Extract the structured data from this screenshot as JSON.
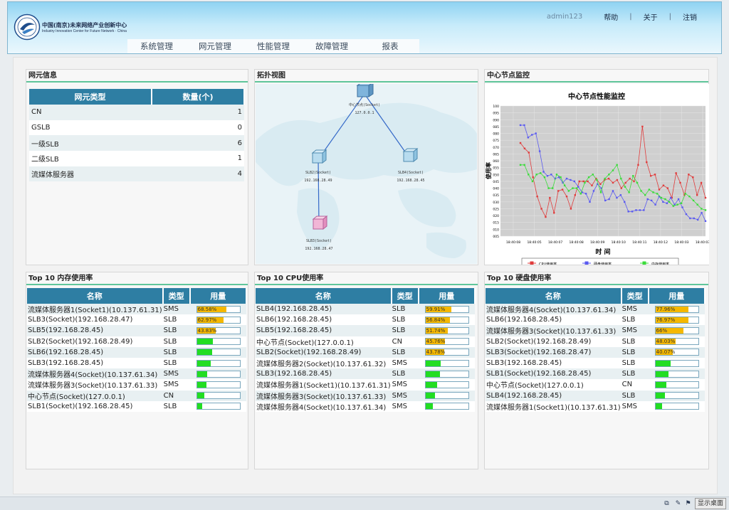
{
  "header": {
    "org_cn": "中国(南京)未来网络产业创新中心",
    "org_en": "Industry Innovation Center for Future Network · China",
    "user": "admin123",
    "links": [
      "帮助",
      "关于",
      "注销"
    ],
    "nav": [
      "系统管理",
      "网元管理",
      "性能管理",
      "故障管理",
      "报表"
    ]
  },
  "ne_info": {
    "title": "网元信息",
    "columns": [
      "网元类型",
      "数量(个)"
    ],
    "rows": [
      {
        "type": "CN",
        "count": "1"
      },
      {
        "type": "GSLB",
        "count": "0"
      },
      {
        "type": "一级SLB",
        "count": "6"
      },
      {
        "type": "二级SLB",
        "count": "1"
      },
      {
        "type": "流媒体服务器",
        "count": "4"
      }
    ]
  },
  "topology": {
    "title": "拓扑视图",
    "nodes": [
      {
        "name": "中心节点(Socket)",
        "ip": "127.0.0.1"
      },
      {
        "name": "SLB2(Socket)",
        "ip": "192.168.28.49"
      },
      {
        "name": "SLB4(Socket)",
        "ip": "192.168.28.45"
      },
      {
        "name": "SLB3(Socket)",
        "ip": "192.168.28.47"
      }
    ]
  },
  "monitor": {
    "title": "中心节点监控",
    "chart_title": "中心节点性能监控",
    "ylabel": "使用率",
    "xlabel": "时 间",
    "xticks": [
      "18:40:08",
      "18:40:05",
      "18:40:07",
      "18:40:08",
      "18:40:09",
      "18:40:10",
      "18:40:11",
      "18:40:12",
      "18:40:03",
      "18:40:03"
    ],
    "yticks": [
      "100",
      "095",
      "090",
      "085",
      "080",
      "075",
      "070",
      "065",
      "060",
      "055",
      "050",
      "045",
      "040",
      "035",
      "030",
      "025",
      "020",
      "015",
      "010",
      "005"
    ],
    "legend": [
      "CPU使用率",
      "硬盘使用率",
      "内存使用率"
    ]
  },
  "chart_data": {
    "type": "line",
    "title": "中心节点性能监控",
    "xlabel": "时 间",
    "ylabel": "使用率",
    "ylim": [
      5,
      100
    ],
    "grid": true,
    "legend_position": "bottom",
    "series": [
      {
        "name": "CPU使用率",
        "color": "#e03c3c",
        "values": [
          73,
          69,
          66,
          48,
          34,
          25,
          19,
          33,
          22,
          38,
          39,
          34,
          25,
          35,
          45,
          45,
          45,
          42,
          47,
          43,
          46,
          47,
          44,
          46,
          40,
          44,
          47,
          45,
          57,
          85,
          59,
          49,
          50,
          39,
          42,
          40,
          33,
          51,
          44,
          35,
          50,
          48,
          35,
          44,
          33
        ]
      },
      {
        "name": "硬盘使用率",
        "color": "#5a5af0",
        "values": [
          86,
          86,
          77,
          79,
          80,
          67,
          52,
          49,
          50,
          47,
          48,
          44,
          47,
          46,
          45,
          41,
          37,
          36,
          30,
          38,
          43,
          40,
          31,
          32,
          38,
          33,
          35,
          30,
          23,
          23,
          24,
          24,
          24,
          32,
          31,
          28,
          34,
          30,
          29,
          33,
          28,
          32,
          26,
          21,
          18,
          18,
          17,
          22,
          16
        ]
      },
      {
        "name": "内存使用率",
        "color": "#3bdc3b",
        "values": [
          57,
          57,
          50,
          45,
          50,
          51,
          48,
          40,
          40,
          50,
          48,
          42,
          38,
          40,
          40,
          36,
          44,
          48,
          50,
          46,
          37,
          47,
          50,
          53,
          57,
          47,
          41,
          37,
          49,
          44,
          38,
          35,
          39,
          37,
          36,
          33,
          32,
          30,
          27,
          28,
          29,
          36,
          34,
          31,
          28,
          25,
          24
        ]
      }
    ]
  },
  "top_mem": {
    "title": "Top 10 内存使用率",
    "columns": [
      "名称",
      "类型",
      "用量"
    ],
    "rows": [
      {
        "name": "流媒体服务器1(Socket1)(10.137.61.31)",
        "type": "SMS",
        "pct": 68.58,
        "label": "68.58%"
      },
      {
        "name": "SLB3(Socket)(192.168.28.47)",
        "type": "SLB",
        "pct": 62.97,
        "label": "62.97%"
      },
      {
        "name": "SLB5(192.168.28.45)",
        "type": "SLB",
        "pct": 43.83,
        "label": "43.83%"
      },
      {
        "name": "SLB2(Socket)(192.168.28.49)",
        "type": "SLB",
        "pct": 38,
        "label": ""
      },
      {
        "name": "SLB6(192.168.28.45)",
        "type": "SLB",
        "pct": 36,
        "label": ""
      },
      {
        "name": "SLB3(192.168.28.45)",
        "type": "SLB",
        "pct": 32,
        "label": ""
      },
      {
        "name": "流媒体服务器4(Socket)(10.137.61.34)",
        "type": "SMS",
        "pct": 24,
        "label": ""
      },
      {
        "name": "流媒体服务器3(Socket)(10.137.61.33)",
        "type": "SMS",
        "pct": 22,
        "label": ""
      },
      {
        "name": "中心节点(Socket)(127.0.0.1)",
        "type": "CN",
        "pct": 18,
        "label": ""
      },
      {
        "name": "SLB1(Socket)(192.168.28.45)",
        "type": "SLB",
        "pct": 12,
        "label": ""
      }
    ]
  },
  "top_cpu": {
    "title": "Top 10 CPU使用率",
    "columns": [
      "名称",
      "类型",
      "用量"
    ],
    "rows": [
      {
        "name": "SLB4(192.168.28.45)",
        "type": "SLB",
        "pct": 59.91,
        "label": "59.91%"
      },
      {
        "name": "SLB6(192.168.28.45)",
        "type": "SLB",
        "pct": 56.84,
        "label": "56.84%"
      },
      {
        "name": "SLB5(192.168.28.45)",
        "type": "SLB",
        "pct": 51.74,
        "label": "51.74%"
      },
      {
        "name": "中心节点(Socket)(127.0.0.1)",
        "type": "CN",
        "pct": 45.76,
        "label": "45.76%"
      },
      {
        "name": "SLB2(Socket)(192.168.28.49)",
        "type": "SLB",
        "pct": 43.78,
        "label": "43.78%"
      },
      {
        "name": "流媒体服务器2(Socket)(10.137.61.32)",
        "type": "SMS",
        "pct": 36,
        "label": ""
      },
      {
        "name": "SLB3(192.168.28.45)",
        "type": "SLB",
        "pct": 34,
        "label": ""
      },
      {
        "name": "流媒体服务器1(Socket1)(10.137.61.31)",
        "type": "SMS",
        "pct": 28,
        "label": ""
      },
      {
        "name": "流媒体服务器3(Socket)(10.137.61.33)",
        "type": "SMS",
        "pct": 22,
        "label": ""
      },
      {
        "name": "流媒体服务器4(Socket)(10.137.61.34)",
        "type": "SMS",
        "pct": 18,
        "label": ""
      }
    ]
  },
  "top_disk": {
    "title": "Top 10 硬盘使用率",
    "columns": [
      "名称",
      "类型",
      "用量"
    ],
    "rows": [
      {
        "name": "流媒体服务器4(Socket)(10.137.61.34)",
        "type": "SMS",
        "pct": 77.96,
        "label": "77.96%"
      },
      {
        "name": "SLB6(192.168.28.45)",
        "type": "SLB",
        "pct": 76.97,
        "label": "76.97%"
      },
      {
        "name": "流媒体服务器3(Socket)(10.137.61.33)",
        "type": "SMS",
        "pct": 66,
        "label": "66%"
      },
      {
        "name": "SLB2(Socket)(192.168.28.49)",
        "type": "SLB",
        "pct": 48.03,
        "label": "48.03%"
      },
      {
        "name": "SLB3(Socket)(192.168.28.47)",
        "type": "SLB",
        "pct": 40.07,
        "label": "40.07%"
      },
      {
        "name": "SLB3(192.168.28.45)",
        "type": "SLB",
        "pct": 36,
        "label": ""
      },
      {
        "name": "SLB1(Socket)(192.168.28.45)",
        "type": "SLB",
        "pct": 30,
        "label": ""
      },
      {
        "name": "中心节点(Socket)(127.0.0.1)",
        "type": "CN",
        "pct": 26,
        "label": ""
      },
      {
        "name": "SLB4(192.168.28.45)",
        "type": "SLB",
        "pct": 22,
        "label": ""
      },
      {
        "name": "流媒体服务器1(Socket1)(10.137.61.31)",
        "type": "SMS",
        "pct": 16,
        "label": ""
      }
    ]
  },
  "taskbar": {
    "show_desktop": "显示桌面"
  }
}
